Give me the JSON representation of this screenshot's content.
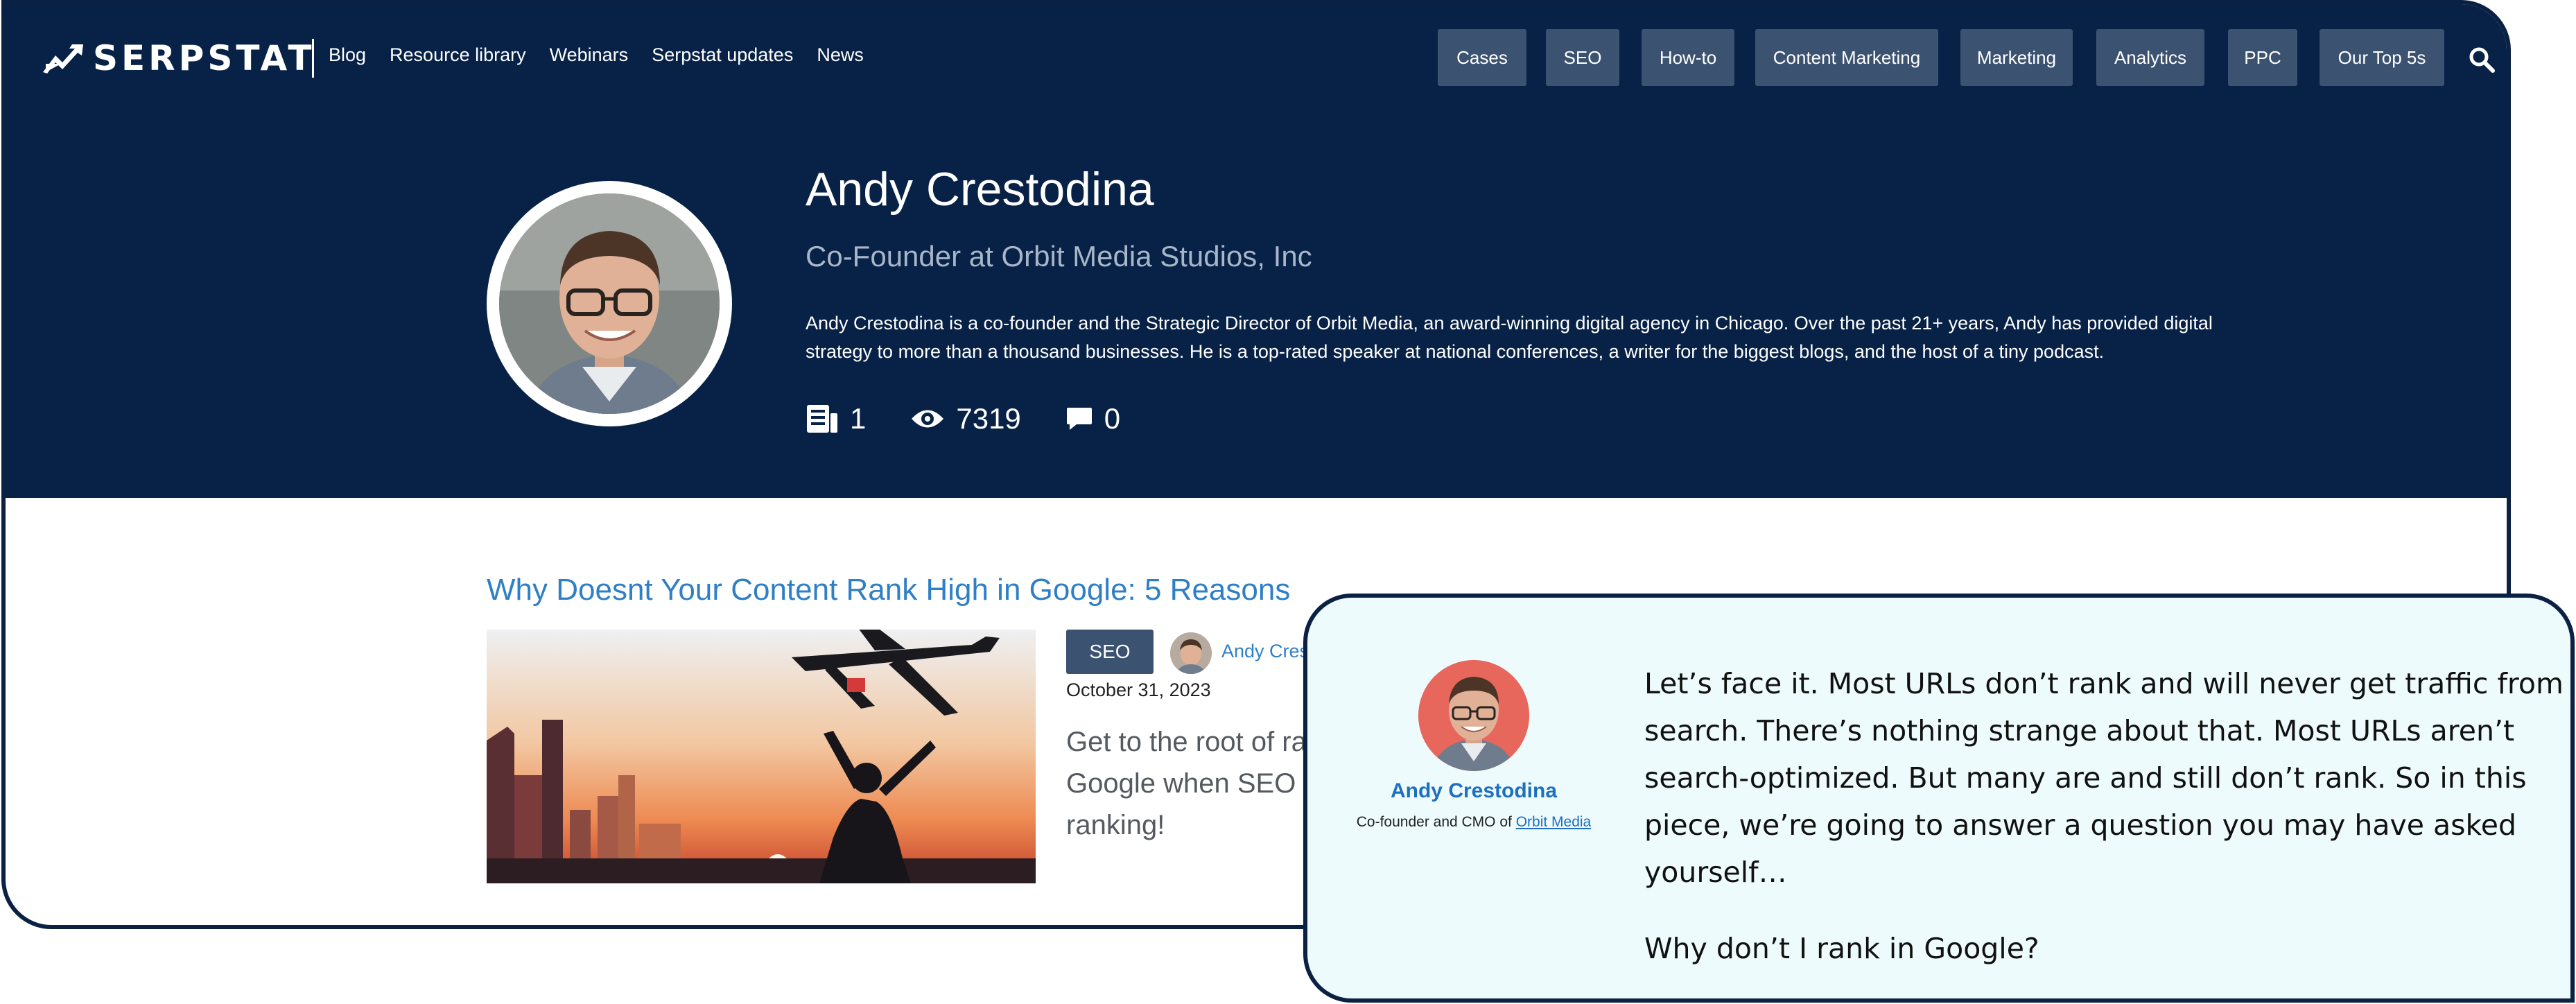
{
  "header": {
    "brand": "SERPSTAT",
    "nav": [
      "Blog",
      "Resource library",
      "Webinars",
      "Serpstat updates",
      "News"
    ],
    "categories": [
      "Cases",
      "SEO",
      "How-to",
      "Content Marketing",
      "Marketing",
      "Analytics",
      "PPC",
      "Our Top 5s"
    ]
  },
  "profile": {
    "name": "Andy Crestodina",
    "role": "Co-Founder at Orbit Media Studios, Inc",
    "bio": "Andy Crestodina is a co-founder and the Strategic Director of Orbit Media, an award-winning digital agency in Chicago. Over the past 21+ years, Andy has provided digital strategy to more than a thousand businesses. He is a top-rated speaker at national conferences, a writer for the biggest blogs, and the host of a tiny podcast.",
    "stats": {
      "articles": "1",
      "views": "7319",
      "comments": "0"
    }
  },
  "article": {
    "title": "Why Doesnt Your Content Rank High in Google: 5 Reasons",
    "tag": "SEO",
    "author": "Andy Cres",
    "date": "October 31, 2023",
    "excerpt_lines": [
      "Get to the root of ran",
      "Google when SEO d",
      "ranking!"
    ]
  },
  "quote": {
    "name": "Andy Crestodina",
    "role_prefix": "Co-founder and CMO of",
    "org": "Orbit Media",
    "text": "Let’s face it. Most URLs don’t rank and will never get traffic from search. There’s nothing strange about that. Most URLs aren’t search-optimized. But many are and still don’t rank. So in this piece, we’re going to answer a question you may have asked yourself…",
    "text2": "Why don’t I rank in Google?"
  },
  "colors": {
    "hero_bg": "#072246",
    "pill_bg": "#3c5271",
    "link": "#2f7fc6",
    "quote_bg": "#eefbfd",
    "quote_avatar_bg": "#e8675d"
  },
  "icons": {
    "logo": "serpstat-logo-icon",
    "search": "search-icon",
    "articles": "articles-icon",
    "views": "eye-icon",
    "comments": "comment-icon"
  }
}
